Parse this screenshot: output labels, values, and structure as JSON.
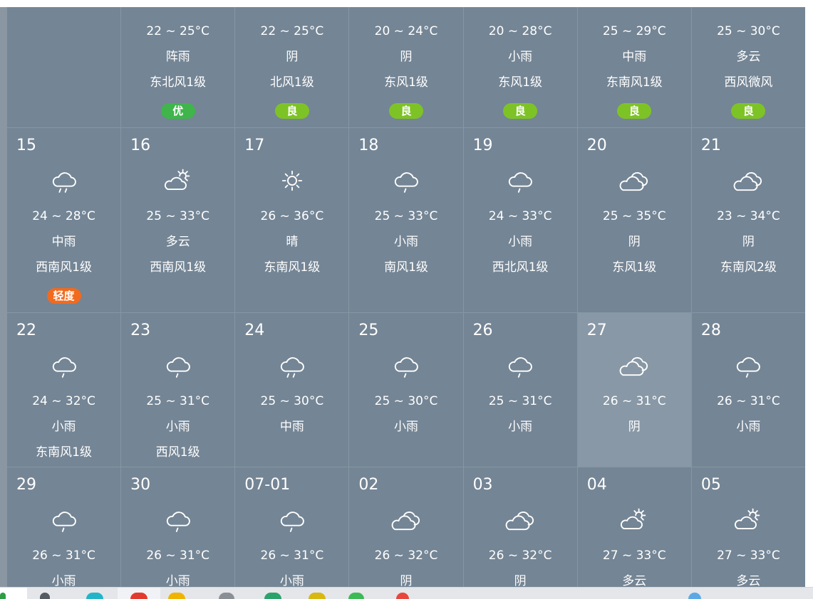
{
  "colors": {
    "cell_bg": "#748595",
    "cell_highlight": "#8898a6",
    "grid_line": "#8596a4",
    "text": "#ffffff",
    "side_strip": "#8a97a3",
    "taskbar_bg": "#e4e6ea",
    "aqi": {
      "优": "#3fb54b",
      "良": "#7dc326",
      "轻度": "#f26a1e"
    }
  },
  "calendar": {
    "rows": [
      {
        "cells": [
          {},
          {
            "temp": "22 ~ 25°C",
            "weather": "阵雨",
            "wind": "东北风1级",
            "aqi": "优"
          },
          {
            "temp": "22 ~ 25°C",
            "weather": "阴",
            "wind": "北风1级",
            "aqi": "良"
          },
          {
            "temp": "20 ~ 24°C",
            "weather": "阴",
            "wind": "东风1级",
            "aqi": "良"
          },
          {
            "temp": "20 ~ 28°C",
            "weather": "小雨",
            "wind": "东风1级",
            "aqi": "良"
          },
          {
            "temp": "25 ~ 29°C",
            "weather": "中雨",
            "wind": "东南风1级",
            "aqi": "良"
          },
          {
            "temp": "25 ~ 30°C",
            "weather": "多云",
            "wind": "西风微风",
            "aqi": "良"
          }
        ]
      },
      {
        "cells": [
          {
            "date": "15",
            "icon": "moderate-rain-icon",
            "temp": "24 ~ 28°C",
            "weather": "中雨",
            "wind": "西南风1级",
            "aqi": "轻度"
          },
          {
            "date": "16",
            "icon": "partly-cloudy-icon",
            "temp": "25 ~ 33°C",
            "weather": "多云",
            "wind": "西南风1级"
          },
          {
            "date": "17",
            "icon": "sunny-icon",
            "temp": "26 ~ 36°C",
            "weather": "晴",
            "wind": "东南风1级"
          },
          {
            "date": "18",
            "icon": "light-rain-icon",
            "temp": "25 ~ 33°C",
            "weather": "小雨",
            "wind": "南风1级"
          },
          {
            "date": "19",
            "icon": "light-rain-icon",
            "temp": "24 ~ 33°C",
            "weather": "小雨",
            "wind": "西北风1级"
          },
          {
            "date": "20",
            "icon": "overcast-icon",
            "temp": "25 ~ 35°C",
            "weather": "阴",
            "wind": "东风1级"
          },
          {
            "date": "21",
            "icon": "overcast-icon",
            "temp": "23 ~ 34°C",
            "weather": "阴",
            "wind": "东南风2级"
          }
        ]
      },
      {
        "cells": [
          {
            "date": "22",
            "icon": "light-rain-icon",
            "temp": "24 ~ 32°C",
            "weather": "小雨",
            "wind": "东南风1级"
          },
          {
            "date": "23",
            "icon": "light-rain-icon",
            "temp": "25 ~ 31°C",
            "weather": "小雨",
            "wind": "西风1级"
          },
          {
            "date": "24",
            "icon": "moderate-rain-icon",
            "temp": "25 ~ 30°C",
            "weather": "中雨"
          },
          {
            "date": "25",
            "icon": "light-rain-icon",
            "temp": "25 ~ 30°C",
            "weather": "小雨"
          },
          {
            "date": "26",
            "icon": "light-rain-icon",
            "temp": "25 ~ 31°C",
            "weather": "小雨"
          },
          {
            "date": "27",
            "icon": "overcast-icon",
            "temp": "26 ~ 31°C",
            "weather": "阴",
            "highlighted": true
          },
          {
            "date": "28",
            "icon": "light-rain-icon",
            "temp": "26 ~ 31°C",
            "weather": "小雨"
          }
        ]
      },
      {
        "cells": [
          {
            "date": "29",
            "icon": "light-rain-icon",
            "temp": "26 ~ 31°C",
            "weather": "小雨"
          },
          {
            "date": "30",
            "icon": "light-rain-icon",
            "temp": "26 ~ 31°C",
            "weather": "小雨"
          },
          {
            "date": "07-01",
            "icon": "light-rain-icon",
            "temp": "26 ~ 31°C",
            "weather": "小雨"
          },
          {
            "date": "02",
            "icon": "overcast-icon",
            "temp": "26 ~ 32°C",
            "weather": "阴"
          },
          {
            "date": "03",
            "icon": "overcast-icon",
            "temp": "26 ~ 32°C",
            "weather": "阴"
          },
          {
            "date": "04",
            "icon": "partly-cloudy-icon",
            "temp": "27 ~ 33°C",
            "weather": "多云"
          },
          {
            "date": "05",
            "icon": "partly-cloudy-icon",
            "temp": "27 ~ 33°C",
            "weather": "多云"
          }
        ]
      }
    ]
  },
  "taskbar": {
    "items": [
      {
        "icon": "start-icon",
        "color": "#2e9e44"
      },
      {
        "icon": "search-icon",
        "color": "#555b63"
      },
      {
        "icon": "app-icon",
        "color": "#22b5c8"
      },
      {
        "icon": "app-icon",
        "color": "#e23b2e"
      },
      {
        "icon": "folder-icon",
        "color": "#f0b400"
      },
      {
        "icon": "document-icon",
        "color": "#8a8f96"
      },
      {
        "icon": "app-icon",
        "color": "#29a36a"
      },
      {
        "icon": "app-icon",
        "color": "#d8b70f"
      },
      {
        "icon": "app-icon",
        "color": "#3cba54"
      },
      {
        "icon": "app-icon",
        "color": "#e8453c"
      },
      {
        "icon": "app-icon",
        "color": "#5aa9e6"
      }
    ]
  }
}
